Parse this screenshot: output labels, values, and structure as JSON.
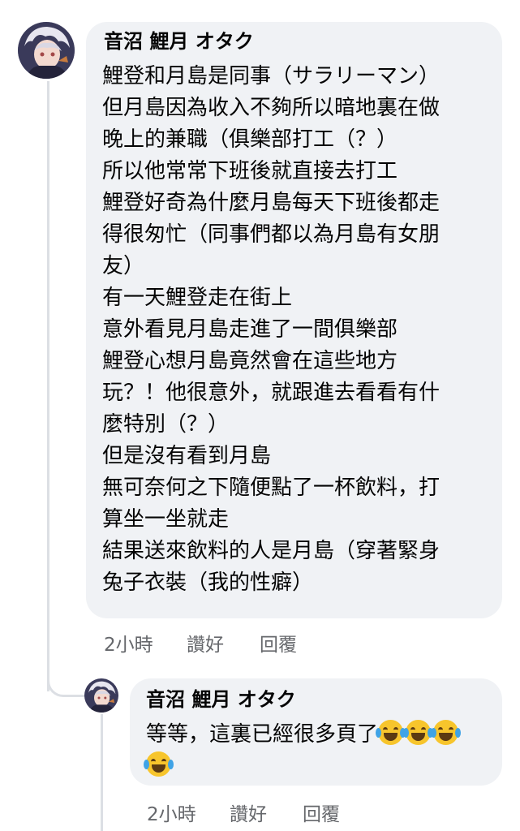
{
  "comment": {
    "author": "音沼 鯉月 オタク",
    "lines": [
      "鯉登和月島是同事（サラリーマン）",
      "但月島因為收入不夠所以暗地裏在做",
      "晚上的兼職（俱樂部打工（？）",
      "所以他常常下班後就直接去打工",
      "鯉登好奇為什麼月島每天下班後都走",
      "得很匆忙（同事們都以為月島有女朋",
      "友）",
      "有一天鯉登走在街上",
      "意外看見月島走進了一間俱樂部",
      "鯉登心想月島竟然會在這些地方",
      "玩？！他很意外，就跟進去看看有什",
      "麼特別（？）",
      "但是沒有看到月島",
      "無可奈何之下隨便點了一杯飲料，打",
      "算坐一坐就走",
      "結果送來飲料的人是月島（穿著緊身",
      "兔子衣裝（我的性癖）"
    ],
    "time": "2小時",
    "like_label": "讚好",
    "reply_label": "回覆"
  },
  "reply": {
    "author": "音沼 鯉月 オタク",
    "line1": "等等，這裏已經很多頁了",
    "emoji": "laughing-tears-emoji",
    "time": "2小時",
    "like_label": "讚好",
    "reply_label": "回覆"
  }
}
